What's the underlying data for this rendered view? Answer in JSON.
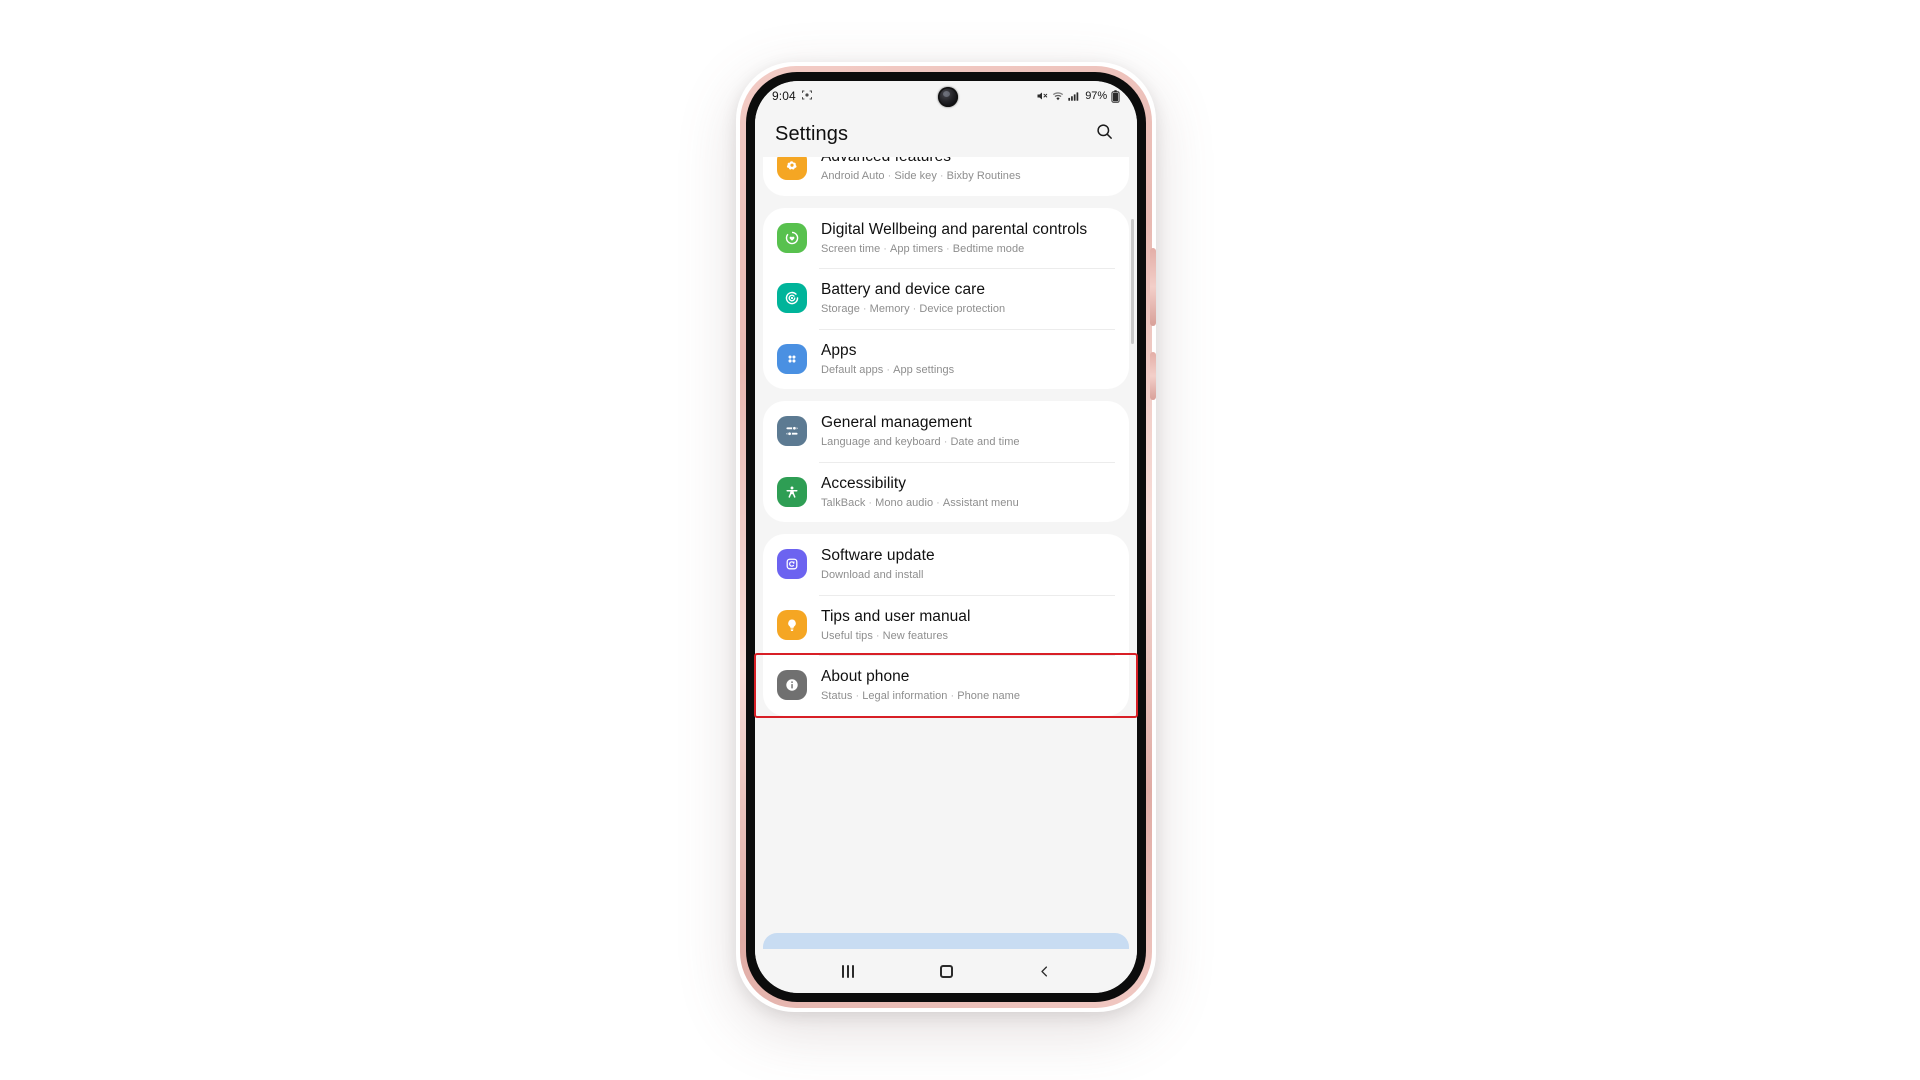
{
  "device": {
    "frame_color": "#eab9b2",
    "bezel_color": "#0c0c0c",
    "screen_bg": "#f5f5f5"
  },
  "status_bar": {
    "time": "9:04",
    "left_icons": [
      "screen-recorder-icon"
    ],
    "right_icons": [
      "mute-icon",
      "wifi-icon",
      "signal-icon"
    ],
    "battery_percent": "97%",
    "battery_icon": "battery-icon"
  },
  "app_bar": {
    "title": "Settings",
    "search_icon": "search-icon"
  },
  "settings_groups": [
    {
      "clipped": true,
      "rows": [
        {
          "title": "Advanced features",
          "subtitle": [
            "Android Auto",
            "Side key",
            "Bixby Routines"
          ],
          "icon": "advanced-features-icon",
          "icon_color": "#f5a623"
        }
      ]
    },
    {
      "rows": [
        {
          "title": "Digital Wellbeing and parental controls",
          "subtitle": [
            "Screen time",
            "App timers",
            "Bedtime mode"
          ],
          "icon": "digital-wellbeing-icon",
          "icon_color": "#58c14e"
        },
        {
          "title": "Battery and device care",
          "subtitle": [
            "Storage",
            "Memory",
            "Device protection"
          ],
          "icon": "battery-device-care-icon",
          "icon_color": "#00b49a"
        },
        {
          "title": "Apps",
          "subtitle": [
            "Default apps",
            "App settings"
          ],
          "icon": "apps-icon",
          "icon_color": "#4a90e2"
        }
      ]
    },
    {
      "rows": [
        {
          "title": "General management",
          "subtitle": [
            "Language and keyboard",
            "Date and time"
          ],
          "icon": "general-management-icon",
          "icon_color": "#5c7a92"
        },
        {
          "title": "Accessibility",
          "subtitle": [
            "TalkBack",
            "Mono audio",
            "Assistant menu"
          ],
          "icon": "accessibility-icon",
          "icon_color": "#2e9e54"
        }
      ]
    },
    {
      "rows": [
        {
          "title": "Software update",
          "subtitle": [
            "Download and install"
          ],
          "icon": "software-update-icon",
          "icon_color": "#6c63f0"
        },
        {
          "title": "Tips and user manual",
          "subtitle": [
            "Useful tips",
            "New features"
          ],
          "icon": "tips-icon",
          "icon_color": "#f5a623"
        },
        {
          "title": "About phone",
          "subtitle": [
            "Status",
            "Legal information",
            "Phone name"
          ],
          "icon": "about-phone-icon",
          "icon_color": "#707070",
          "highlighted": true
        }
      ]
    }
  ],
  "nav_bar": {
    "recents_label": "recents-icon",
    "home_label": "home-icon",
    "back_label": "back-icon"
  },
  "annotation": {
    "color": "#d81f26",
    "target": "About phone"
  }
}
